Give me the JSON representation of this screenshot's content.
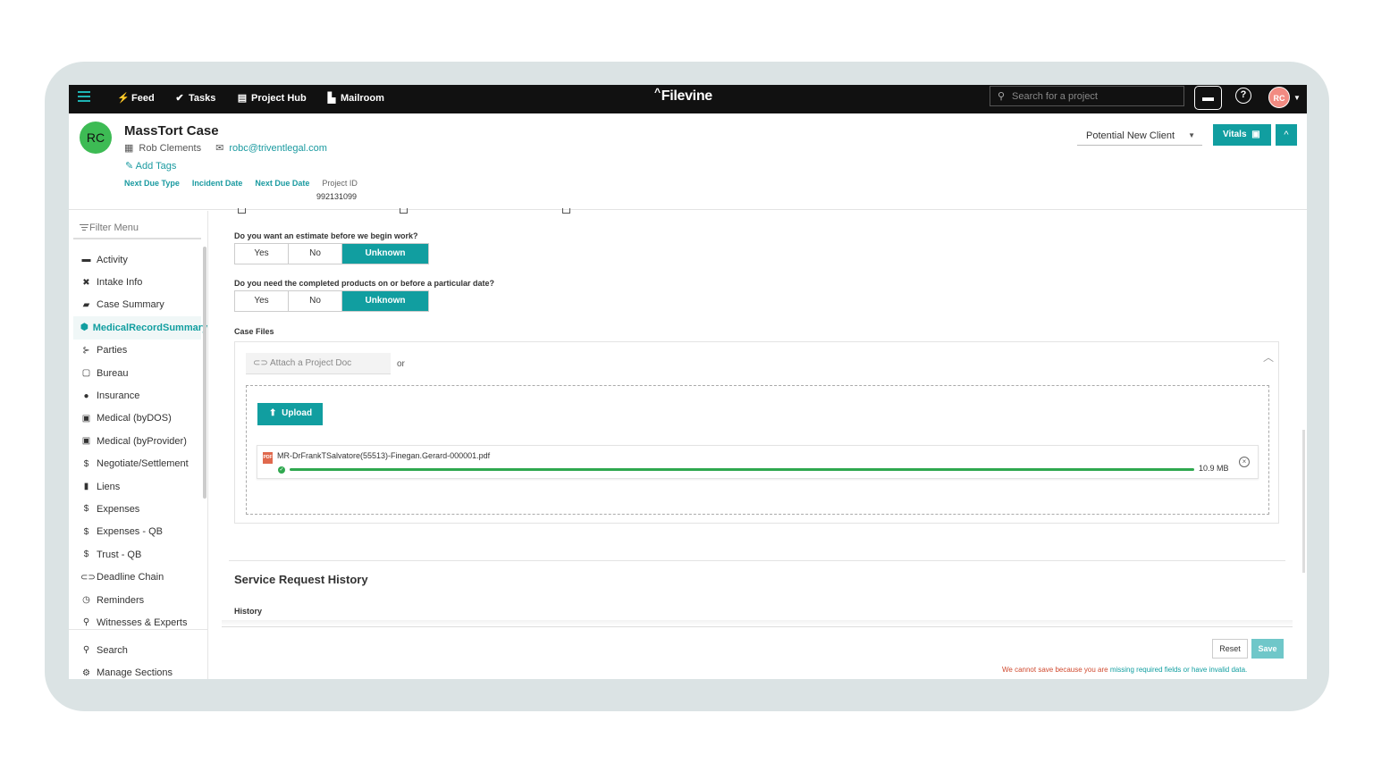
{
  "nav": {
    "feed": "Feed",
    "tasks": "Tasks",
    "project_hub": "Project Hub",
    "mailroom": "Mailroom",
    "logo": "Filevine",
    "search_placeholder": "Search for a project",
    "user_initials": "RC"
  },
  "header": {
    "initials": "RC",
    "case_title": "MassTort Case",
    "contact_name": "Rob Clements",
    "contact_email": "robc@triventlegal.com",
    "add_tags": "Add Tags",
    "fields": {
      "next_due_type": "Next Due Type",
      "incident_date": "Incident Date",
      "next_due_date": "Next Due Date",
      "project_id_label": "Project ID",
      "project_id_value": "992131099"
    },
    "status": "Potential New Client",
    "vitals": "Vitals"
  },
  "sidebar": {
    "filter": "Filter Menu",
    "items": [
      {
        "label": "Activity",
        "icon": "activity-icon",
        "glyph": "▬"
      },
      {
        "label": "Intake Info",
        "icon": "wrench-icon",
        "glyph": "✖"
      },
      {
        "label": "Case Summary",
        "icon": "briefcase-icon",
        "glyph": "▰"
      },
      {
        "label": "MedicalRecordSummary",
        "icon": "shield-icon",
        "glyph": "⬢",
        "active": true
      },
      {
        "label": "Parties",
        "icon": "parties-icon",
        "glyph": "⊱"
      },
      {
        "label": "Bureau",
        "icon": "monitor-icon",
        "glyph": "▢"
      },
      {
        "label": "Insurance",
        "icon": "globe-icon",
        "glyph": "●"
      },
      {
        "label": "Medical (byDOS)",
        "icon": "clipboard-icon",
        "glyph": "▣"
      },
      {
        "label": "Medical (byProvider)",
        "icon": "clipboard-icon",
        "glyph": "▣"
      },
      {
        "label": "Negotiate/Settlement",
        "icon": "dollar-icon",
        "glyph": "$"
      },
      {
        "label": "Liens",
        "icon": "book-icon",
        "glyph": "▮"
      },
      {
        "label": "Expenses",
        "icon": "dollar-icon",
        "glyph": "$"
      },
      {
        "label": "Expenses - QB",
        "icon": "dollar-icon",
        "glyph": "$"
      },
      {
        "label": "Trust - QB",
        "icon": "dollar-icon",
        "glyph": "$"
      },
      {
        "label": "Deadline Chain",
        "icon": "chain-icon",
        "glyph": "⊂⊃"
      },
      {
        "label": "Reminders",
        "icon": "clock-icon",
        "glyph": "◷"
      },
      {
        "label": "Witnesses & Experts",
        "icon": "search-icon",
        "glyph": "⚲"
      }
    ],
    "search": "Search",
    "manage_sections": "Manage Sections"
  },
  "form": {
    "q1": "Do you want an estimate before we begin work?",
    "q2": "Do you need the completed products on or before a particular date?",
    "options": [
      "Yes",
      "No",
      "Unknown"
    ],
    "q1_selected": "Unknown",
    "q2_selected": "Unknown",
    "case_files_label": "Case Files",
    "attach_doc": "Attach a Project Doc",
    "or": "or",
    "upload": "Upload",
    "file": {
      "name": "MR-DrFrankTSalvatore(55513)-Finegan.Gerard-000001.pdf",
      "size": "10.9 MB",
      "progress": 1.0
    },
    "service_history_title": "Service Request History",
    "history_label": "History",
    "reset": "Reset",
    "save": "Save",
    "error_prefix": "We cannot save because you are ",
    "error_highlight": "missing required fields or have invalid data.",
    "accent_color": "#119ea0",
    "success_color": "#2fa84f",
    "error_color": "#d04a2f"
  }
}
